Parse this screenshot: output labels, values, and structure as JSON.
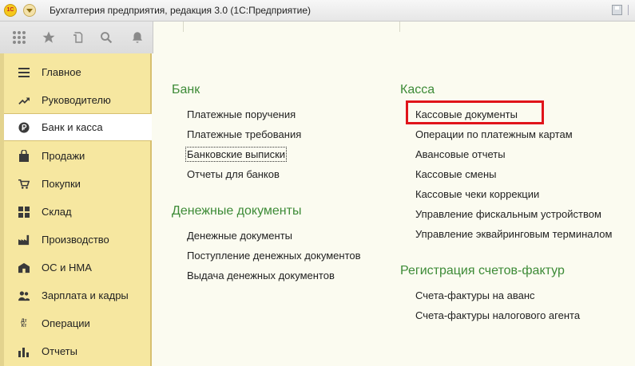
{
  "window": {
    "logo_text": "1С",
    "title": "Бухгалтерия предприятия, редакция 3.0  (1С:Предприятие)"
  },
  "toolbar": {
    "tools": [
      {
        "icon": "apps-grid-icon"
      },
      {
        "icon": "star-icon"
      },
      {
        "icon": "history-icon"
      },
      {
        "icon": "search-icon"
      },
      {
        "icon": "bell-icon"
      }
    ]
  },
  "sidebar": {
    "active_index": 2,
    "items": [
      {
        "label": "Главное",
        "icon": "menu-lines-icon"
      },
      {
        "label": "Руководителю",
        "icon": "trend-up-icon"
      },
      {
        "label": "Банк и касса",
        "icon": "ruble-icon"
      },
      {
        "label": "Продажи",
        "icon": "shopping-bag-icon"
      },
      {
        "label": "Покупки",
        "icon": "cart-icon"
      },
      {
        "label": "Склад",
        "icon": "warehouse-icon"
      },
      {
        "label": "Производство",
        "icon": "factory-icon"
      },
      {
        "label": "ОС и НМА",
        "icon": "building-icon"
      },
      {
        "label": "Зарплата и кадры",
        "icon": "people-icon"
      },
      {
        "label": "Операции",
        "icon": "debit-credit-icon",
        "icon_text": "Дт\nКт"
      },
      {
        "label": "Отчеты",
        "icon": "bar-chart-icon"
      }
    ]
  },
  "groups": {
    "bank": {
      "title": "Банк",
      "links": [
        "Платежные поручения",
        "Платежные требования",
        "Банковские выписки",
        "Отчеты для банков"
      ]
    },
    "money_docs": {
      "title": "Денежные документы",
      "links": [
        "Денежные документы",
        "Поступление денежных документов",
        "Выдача денежных документов"
      ]
    },
    "cash": {
      "title": "Касса",
      "links": [
        "Кассовые документы",
        "Операции по платежным картам",
        "Авансовые отчеты",
        "Кассовые смены",
        "Кассовые чеки коррекции",
        "Управление фискальным устройством",
        "Управление эквайринговым терминалом"
      ]
    },
    "invoices": {
      "title": "Регистрация счетов-фактур",
      "links": [
        "Счета-фактуры на аванс",
        "Счета-фактуры налогового агента"
      ]
    }
  },
  "colors": {
    "group_title": "#3d8b37",
    "sidebar_bg": "#f6e7a0",
    "highlight": "#e0141a"
  }
}
